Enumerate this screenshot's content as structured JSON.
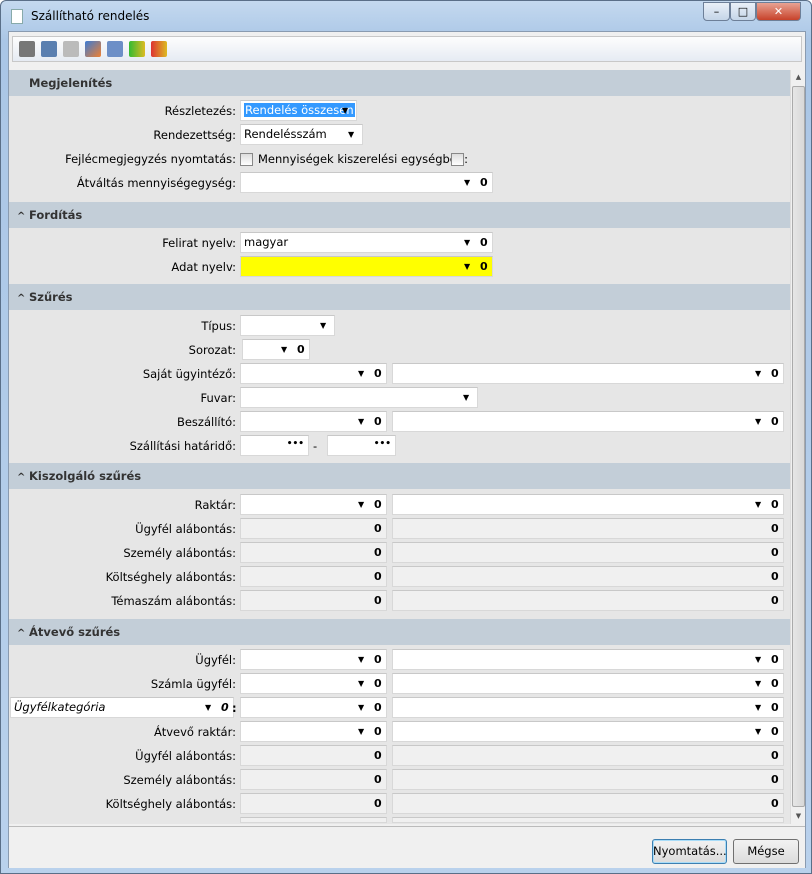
{
  "window": {
    "title": "Szállítható rendelés",
    "minimize": "–",
    "maximize": "□",
    "close": "✕"
  },
  "toolbar": {
    "icons": [
      "printer-icon",
      "print-preview-icon",
      "copy-icon",
      "edit-icon",
      "calculator-icon",
      "database-load-icon",
      "database-save-icon"
    ]
  },
  "sections": {
    "megjelenites": {
      "title": "Megjelenítés",
      "reszletezes": {
        "label": "Részletezés:",
        "value": "Rendelés összesen"
      },
      "rendezettseg": {
        "label": "Rendezettség:",
        "value": "Rendelésszám"
      },
      "fejlec": {
        "label": "Fejlécmegjegyzés nyomtatás:",
        "checked": false
      },
      "mennyisegek": {
        "label": "Mennyiségek kiszerelési egységben:",
        "checked": false
      },
      "atvaltas": {
        "label": "Átváltás mennyiségegység:",
        "value": ""
      }
    },
    "forditas": {
      "title": "Fordítás",
      "felirat": {
        "label": "Felirat nyelv:",
        "value": "magyar"
      },
      "adat": {
        "label": "Adat nyelv:",
        "value": "",
        "highlight": "#ffff00"
      }
    },
    "szures": {
      "title": "Szűrés",
      "tipus": {
        "label": "Típus:",
        "value": ""
      },
      "sorozat": {
        "label": "Sorozat:",
        "value": ""
      },
      "sajat": {
        "label": "Saját ügyintéző:",
        "value": ""
      },
      "fuvar": {
        "label": "Fuvar:",
        "value": ""
      },
      "beszallito": {
        "label": "Beszállító:",
        "value": ""
      },
      "hatarido": {
        "label": "Szállítási határidő:",
        "from": "",
        "separator": "-",
        "to": ""
      }
    },
    "kiszolgalo": {
      "title": "Kiszolgáló szűrés",
      "raktar": {
        "label": "Raktár:"
      },
      "ugyfel_al": {
        "label": "Ügyfél alábontás:"
      },
      "szemely_al": {
        "label": "Személy alábontás:"
      },
      "koltseg_al": {
        "label": "Költséghely alábontás:"
      },
      "temaszam_al": {
        "label": "Témaszám alábontás:"
      }
    },
    "atvevo": {
      "title": "Átvevő szűrés",
      "ugyfel": {
        "label": "Ügyfél:"
      },
      "szamla": {
        "label": "Számla ügyfél:"
      },
      "kategoria": {
        "value": "Ügyfélkategória",
        "separator": ":"
      },
      "raktar": {
        "label": "Átvevő raktár:"
      },
      "ugyfel_al": {
        "label": "Ügyfél alábontás:"
      },
      "szemely_al": {
        "label": "Személy alábontás:"
      },
      "koltseg_al": {
        "label": "Költséghely alábontás:"
      }
    }
  },
  "glyphs": {
    "dropdown": "▼",
    "attach": "0",
    "ellipsis": "•••",
    "collapse": "^"
  },
  "buttons": {
    "print": "Nyomtatás...",
    "cancel": "Mégse"
  }
}
